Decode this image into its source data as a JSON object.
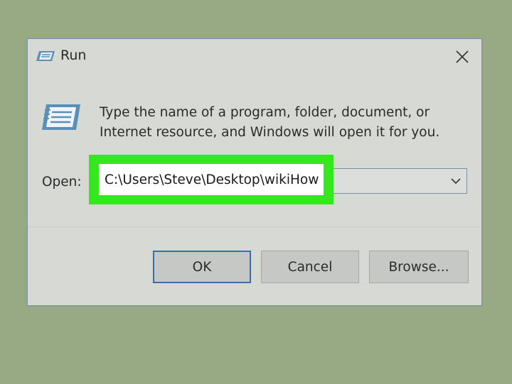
{
  "window": {
    "title": "Run",
    "icon": "run-icon",
    "close_icon": "close-icon"
  },
  "content": {
    "description_line1": "Type the name of a program, folder, document, or",
    "description_line2": "Internet resource, and Windows will open it for you.",
    "open_label": "Open:",
    "open_value": "C:\\Users\\Steve\\Desktop\\wikiHow",
    "highlight_color": "#35e81e"
  },
  "buttons": {
    "ok": "OK",
    "cancel": "Cancel",
    "browse": "Browse..."
  }
}
